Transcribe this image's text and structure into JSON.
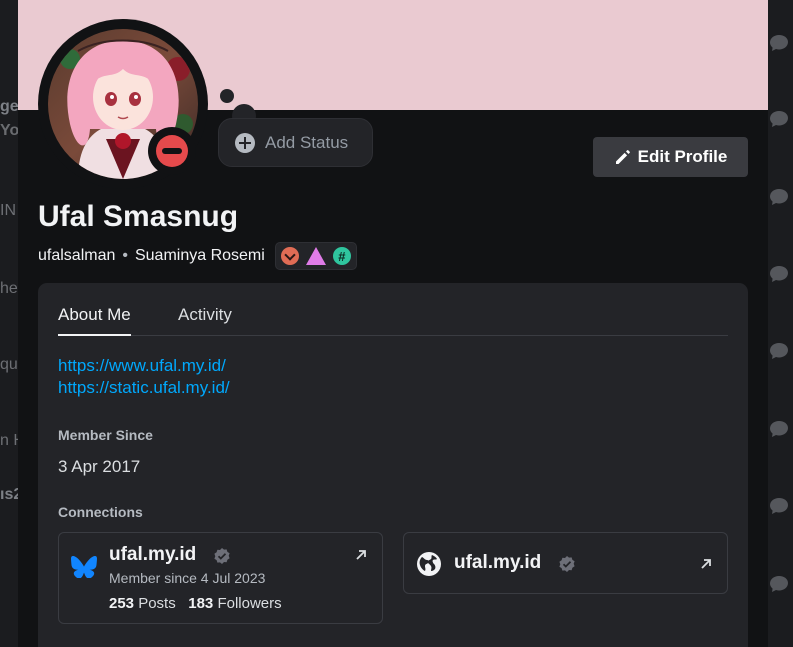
{
  "background": {
    "snippets": [
      "ge",
      "Yo",
      "IN",
      "he",
      "qu",
      "n H",
      "ıs2"
    ]
  },
  "profile": {
    "display_name": "Ufal Smasnug",
    "username": "ufalsalman",
    "pronouns_or_tag": "Suaminya Rosemi",
    "status_placeholder": "Add Status",
    "edit_button": "Edit Profile",
    "banner_color": "#eacad1",
    "status": "do-not-disturb",
    "badges": [
      "chevron-badge-icon",
      "triangle-badge-icon",
      "hash-badge-icon"
    ]
  },
  "tabs": [
    {
      "label": "About Me",
      "active": true
    },
    {
      "label": "Activity",
      "active": false
    }
  ],
  "about": {
    "links": [
      "https://www.ufal.my.id/",
      "https://static.ufal.my.id/"
    ],
    "member_since_title": "Member Since",
    "member_since": "3 Apr 2017",
    "connections_title": "Connections"
  },
  "connections": [
    {
      "service_icon": "bluesky-icon",
      "name": "ufal.my.id",
      "subtitle": "Member since 4 Jul 2023",
      "posts_count": "253",
      "posts_label": "Posts",
      "followers_count": "183",
      "followers_label": "Followers"
    },
    {
      "service_icon": "globe-icon",
      "name": "ufal.my.id"
    }
  ],
  "colors": {
    "link": "#00a8fc",
    "dnd": "#e54a4c"
  }
}
